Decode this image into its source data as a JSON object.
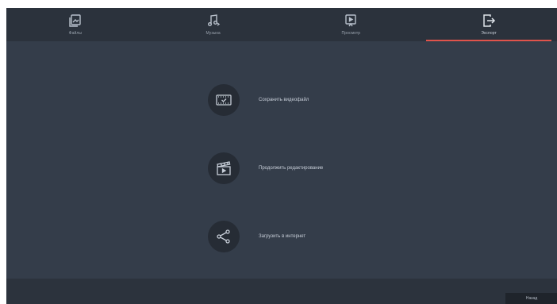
{
  "tabs": [
    {
      "label": "Файлы",
      "icon": "files-icon"
    },
    {
      "label": "Музыка",
      "icon": "music-icon"
    },
    {
      "label": "Просмотр",
      "icon": "preview-icon"
    },
    {
      "label": "Экспорт",
      "icon": "export-icon",
      "active": true
    }
  ],
  "actions": [
    {
      "label": "Сохранить видеофайл",
      "icon": "film-check-icon"
    },
    {
      "label": "Продолжить редактирование",
      "icon": "clapperboard-icon"
    },
    {
      "label": "Загрузить в интернет",
      "icon": "share-icon"
    }
  ],
  "footer": {
    "back_label": "Назад"
  },
  "colors": {
    "background": "#343d4a",
    "topbar": "#2b323c",
    "accent": "#e0534b",
    "icon_circle": "#262c35"
  }
}
